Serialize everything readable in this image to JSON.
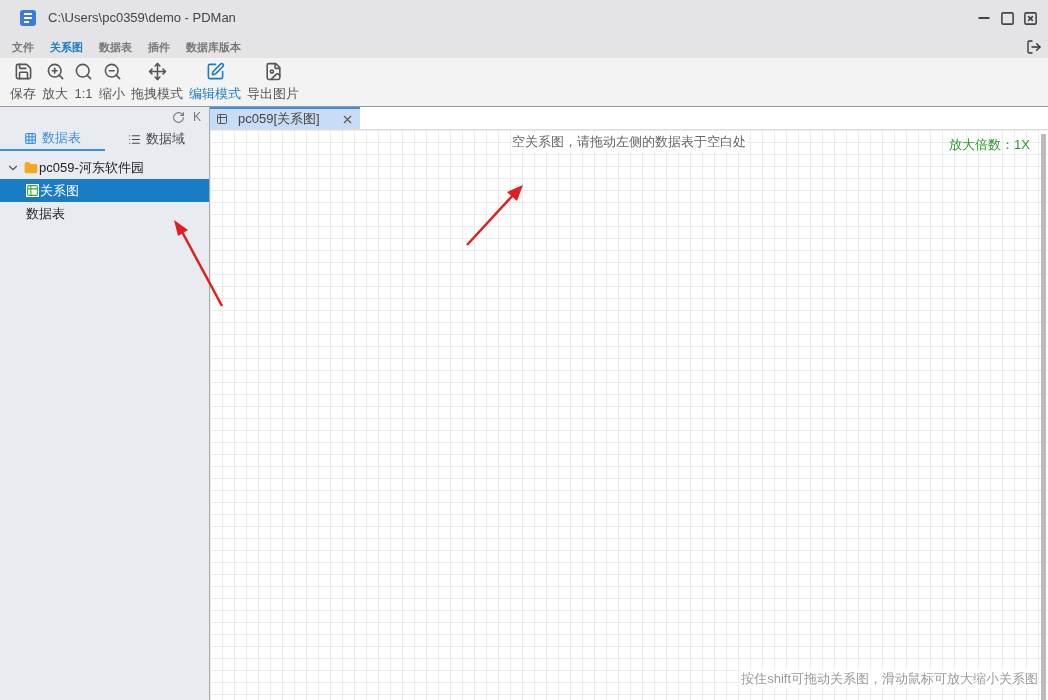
{
  "window": {
    "title": "C:\\Users\\pc0359\\demo - PDMan"
  },
  "menu": [
    {
      "label": "文件",
      "selected": false
    },
    {
      "label": "关系图",
      "selected": true
    },
    {
      "label": "数据表",
      "selected": false
    },
    {
      "label": "插件",
      "selected": false
    },
    {
      "label": "数据库版本",
      "selected": false
    }
  ],
  "toolbar": [
    {
      "label": "保存",
      "kind": "save",
      "selected": false
    },
    {
      "label": "放大",
      "kind": "zoomin",
      "selected": false
    },
    {
      "label": "1:1",
      "kind": "actual",
      "selected": false
    },
    {
      "label": "缩小",
      "kind": "zoomout",
      "selected": false
    },
    {
      "label": "拖拽模式",
      "kind": "move",
      "selected": false
    },
    {
      "label": "编辑模式",
      "kind": "edit",
      "selected": true
    },
    {
      "label": "导出图片",
      "kind": "export",
      "selected": false
    }
  ],
  "sidebar": {
    "collapse_label": "K",
    "tabs": [
      {
        "label": "数据表",
        "kind": "tables",
        "selected": true
      },
      {
        "label": "数据域",
        "kind": "domains",
        "selected": false
      }
    ],
    "tree": [
      {
        "label": "pc059-河东软件园",
        "expanded": true,
        "kind": "folder",
        "children": [
          {
            "label": "关系图",
            "kind": "diagram",
            "selected": true
          },
          {
            "label": "数据表",
            "kind": "plain",
            "selected": false
          }
        ]
      }
    ]
  },
  "editor_tabs": [
    {
      "label": "pc059[关系图]",
      "selected": true
    }
  ],
  "canvas": {
    "hint": "空关系图，请拖动左侧的数据表于空白处",
    "zoom": "放大倍数：1X",
    "footer": "按住shift可拖动关系图，滑动鼠标可放大缩小关系图"
  }
}
